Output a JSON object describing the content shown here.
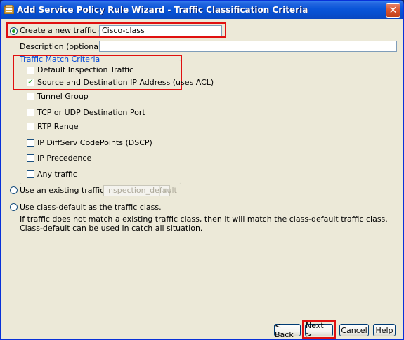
{
  "window": {
    "title": "Add Service Policy Rule Wizard - Traffic Classification Criteria",
    "close_glyph": "✕"
  },
  "create_new": {
    "label": "Create a new traffic class:",
    "value": "Cisco-class",
    "selected": true
  },
  "description": {
    "label": "Description (optional):",
    "value": ""
  },
  "traffic_match": {
    "legend": "Traffic Match Criteria",
    "options": [
      {
        "label": "Default Inspection Traffic",
        "checked": false
      },
      {
        "label": "Source and Destination IP Address (uses ACL)",
        "checked": true
      },
      {
        "label": "Tunnel Group",
        "checked": false
      },
      {
        "label": "TCP or UDP Destination Port",
        "checked": false
      },
      {
        "label": "RTP Range",
        "checked": false
      },
      {
        "label": "IP DiffServ CodePoints (DSCP)",
        "checked": false
      },
      {
        "label": "IP Precedence",
        "checked": false
      },
      {
        "label": "Any traffic",
        "checked": false
      }
    ]
  },
  "use_existing": {
    "label": "Use an existing traffic class:",
    "value": "inspection_default",
    "selected": false
  },
  "class_default": {
    "label": "Use class-default as the traffic class.",
    "selected": false,
    "description": "If traffic does not match a existing traffic class, then it will match the class-default traffic class. Class-default can be used in catch all situation."
  },
  "buttons": {
    "back": "< Back",
    "next": "Next >",
    "cancel": "Cancel",
    "help": "Help"
  },
  "colors": {
    "highlight": "#e01010",
    "titlebar": "#0a55d8",
    "legend": "#0046d5"
  }
}
